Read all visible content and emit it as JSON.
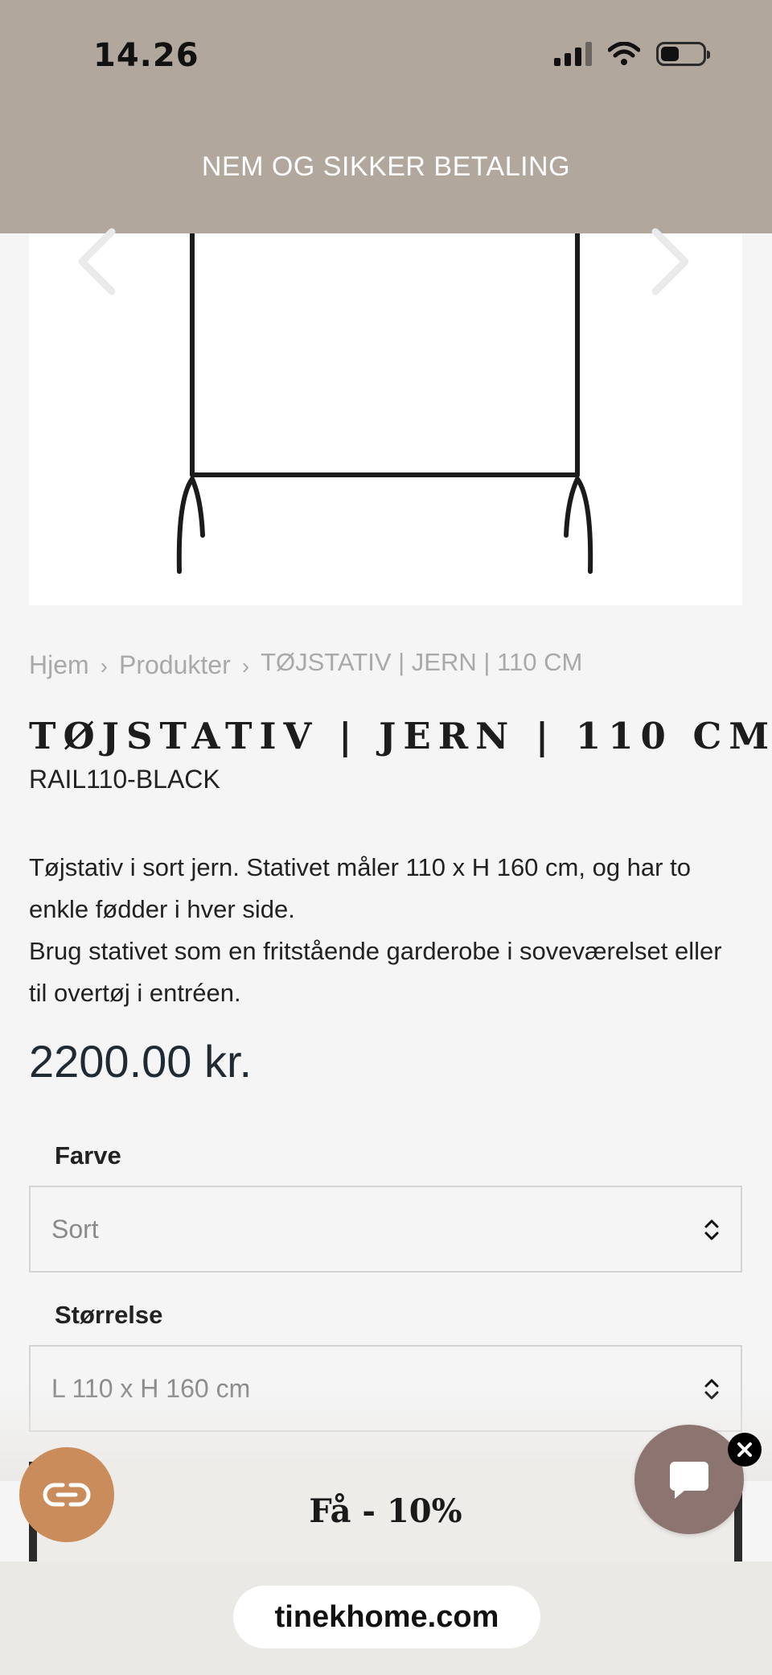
{
  "status_bar": {
    "time": "14.26"
  },
  "announcement": "NEM OG SIKKER BETALING",
  "breadcrumb": {
    "home": "Hjem",
    "products": "Produkter",
    "current": "TØJSTATIV | JERN | 110 CM",
    "separator": "›"
  },
  "product": {
    "title": "TØJSTATIV | JERN | 110 CM",
    "sku": "RAIL110-BLACK",
    "description": [
      "Tøjstativ i sort jern. Stativet måler 110 x H 160 cm, og har to enkle fødder i hver side.",
      "Brug stativet som en fritstående garderobe i soveværelset eller til overtøj i entréen."
    ],
    "price": "2200.00 kr."
  },
  "options": {
    "color": {
      "label": "Farve",
      "value": "Sort"
    },
    "size": {
      "label": "Størrelse",
      "value": "L 110 x H 160 cm"
    }
  },
  "promo": {
    "text": "Få - 10%"
  },
  "browser": {
    "url": "tinekhome.com"
  },
  "icons": {
    "prev": "chevron-left-icon",
    "next": "chevron-right-icon",
    "loyalty": "loyalty-icon",
    "chat": "chat-icon",
    "close": "close-icon"
  },
  "colors": {
    "header_bg": "#b1a79d",
    "loyalty_button": "#c98c5a",
    "chat_button": "#8c7471",
    "price_text": "#1f2a33"
  }
}
